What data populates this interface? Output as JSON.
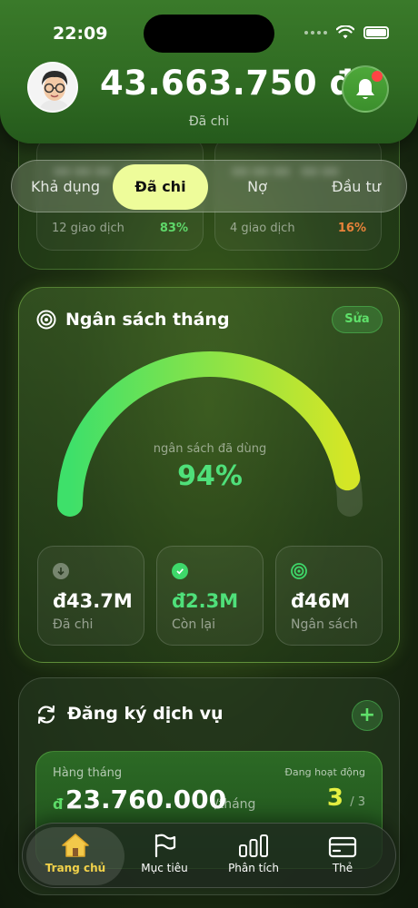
{
  "status_bar": {
    "time": "22:09"
  },
  "header": {
    "balance": "43.663.750 đ",
    "balance_caption": "Đã chi"
  },
  "summary_cards": [
    {
      "count": "12 giao dịch",
      "percent": "83%",
      "percent_color": "#5fd86a"
    },
    {
      "count": "4 giao dịch",
      "percent": "16%",
      "percent_color": "#e8823a"
    }
  ],
  "tabs": [
    {
      "label": "Khả dụng",
      "active": false
    },
    {
      "label": "Đã chi",
      "active": true
    },
    {
      "label": "Nợ",
      "active": false
    },
    {
      "label": "Đầu tư",
      "active": false
    }
  ],
  "budget": {
    "title": "Ngân sách tháng",
    "edit_label": "Sửa",
    "gauge_caption": "ngân sách đã dùng",
    "gauge_percent": 94,
    "gauge_percent_label": "94%",
    "stats": [
      {
        "value": "đ43.7M",
        "label": "Đã chi",
        "icon": "arrow-down-icon",
        "color": "#ffffff"
      },
      {
        "value": "đ2.3M",
        "label": "Còn lại",
        "icon": "check-icon",
        "color": "#4fe07a"
      },
      {
        "value": "đ46M",
        "label": "Ngân sách",
        "icon": "target-icon",
        "color": "#ffffff"
      }
    ]
  },
  "subscriptions": {
    "title": "Đăng ký dịch vụ",
    "add_label": "+",
    "monthly_label": "Hàng tháng",
    "currency": "đ",
    "amount": "23.760.000",
    "unit": "/tháng",
    "status_label": "Đang hoạt động",
    "active_count": "3",
    "total_count": "/ 3"
  },
  "bottom_nav": [
    {
      "label": "Trang chủ",
      "icon": "home-icon",
      "active": true
    },
    {
      "label": "Mục tiêu",
      "icon": "flag-icon",
      "active": false
    },
    {
      "label": "Phân tích",
      "icon": "bar-chart-icon",
      "active": false
    },
    {
      "label": "Thẻ",
      "icon": "card-icon",
      "active": false
    }
  ],
  "colors": {
    "accent_green": "#4fe07a",
    "tab_active_bg": "#eefc9a",
    "nav_active_label": "#f2d24a"
  }
}
